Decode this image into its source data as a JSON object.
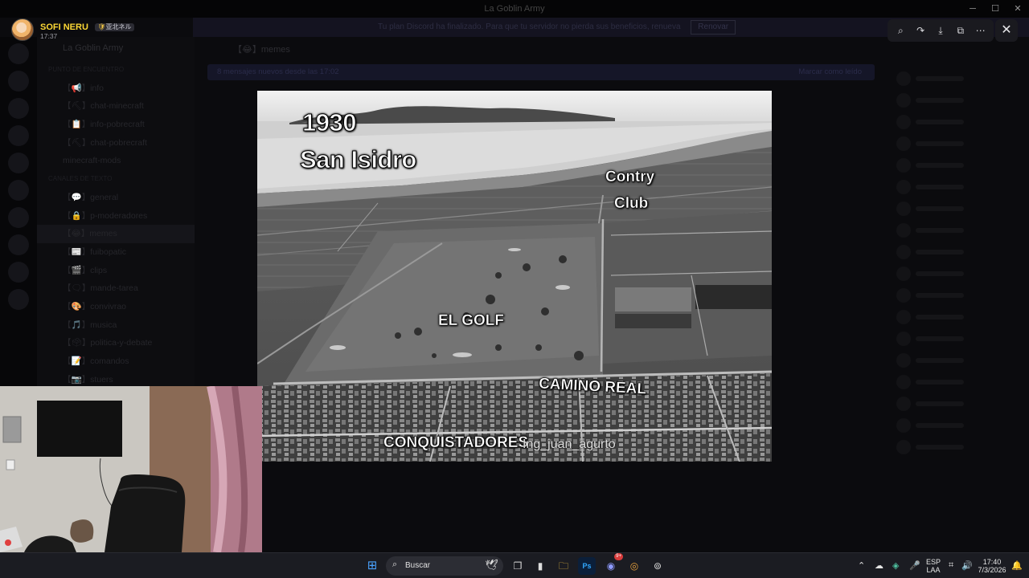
{
  "window": {
    "title": "La Goblin Army",
    "controls": [
      "─",
      "☐",
      "✕"
    ]
  },
  "discord": {
    "banner_text": "Tu plan Discord ha finalizado. Para que tu servidor no pierda sus beneficios, renueva",
    "banner_button": "Renovar",
    "server_name": "La Goblin Army",
    "channels": [
      {
        "label": "PUNTO DE ENCUENTRO",
        "type": "cat"
      },
      {
        "label": "【📢】info",
        "type": "ch"
      },
      {
        "label": "【⛏】chat-minecraft",
        "type": "ch"
      },
      {
        "label": "【📋】info-pobrecraft",
        "type": "ch"
      },
      {
        "label": "【⛏】chat-pobrecraft",
        "type": "ch"
      },
      {
        "label": "minecraft-mods",
        "type": "ch"
      },
      {
        "label": "CANALES DE TEXTO",
        "type": "cat"
      },
      {
        "label": "【💬】general",
        "type": "ch"
      },
      {
        "label": "【🔒】p-moderadores",
        "type": "ch"
      },
      {
        "label": "【😂】memes",
        "type": "sel"
      },
      {
        "label": "【📰】fuibopatic",
        "type": "ch"
      },
      {
        "label": "【🎬】clips",
        "type": "ch"
      },
      {
        "label": "【🗨】mande-tarea",
        "type": "ch"
      },
      {
        "label": "【🎨】convivrao",
        "type": "ch"
      },
      {
        "label": "【🎵】musica",
        "type": "ch"
      },
      {
        "label": "【🗳】politica-y-debate",
        "type": "ch"
      },
      {
        "label": "【📝】comandos",
        "type": "ch"
      },
      {
        "label": "【📷】stuers",
        "type": "ch"
      }
    ],
    "chat_header": "【😂】memes",
    "new_messages": "8 mensajes nuevos desde las 17:02",
    "mark_read": "Marcar como leído"
  },
  "viewer": {
    "username": "SOFI NERU",
    "tag": "亚北ネル",
    "time": "17:37",
    "tools": [
      "⌕",
      "↷",
      "⤓",
      "⧉",
      "⋯"
    ],
    "close": "✕"
  },
  "photo": {
    "year": "1930",
    "district": "San Isidro",
    "label_contry": "Contry",
    "label_club": "Club",
    "label_golf": "EL GOLF",
    "label_camino": "CAMINO REAL",
    "label_conquistadores": "CONQUISTADORES",
    "watermark": "Ing_juan_agurto"
  },
  "taskbar": {
    "search_placeholder": "Buscar",
    "language_top": "ESP",
    "language_bottom": "LAA",
    "time": "17:40",
    "date": "7/3/2026",
    "discord_badge": "9+"
  }
}
